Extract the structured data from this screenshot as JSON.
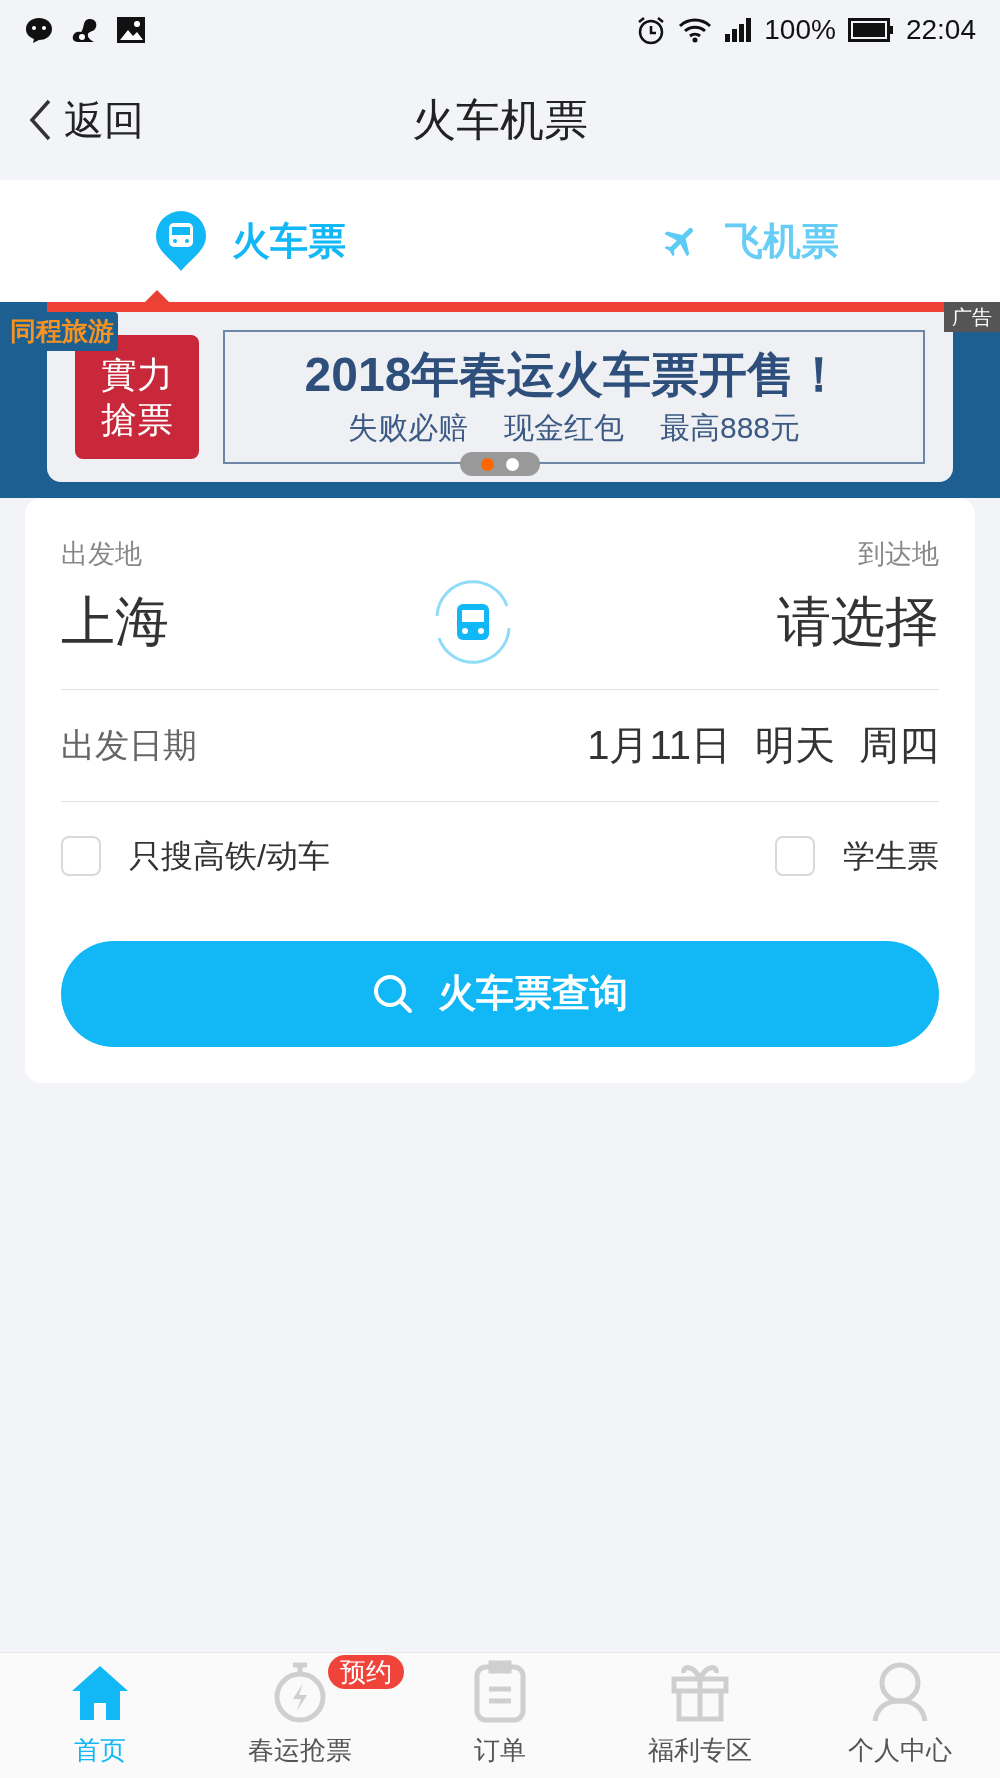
{
  "status_bar": {
    "battery": "100%",
    "time": "22:04"
  },
  "header": {
    "back": "返回",
    "title": "火车机票"
  },
  "tabs": [
    {
      "label": "火车票",
      "kind": "train",
      "selected": true
    },
    {
      "label": "飞机票",
      "kind": "plane",
      "selected": false
    }
  ],
  "banner": {
    "brand": "同程旅游",
    "ad_tag": "广告",
    "stamp": [
      "實力",
      "搶票"
    ],
    "headline": "2018年春运火车票开售！",
    "subline": [
      "失败必赔",
      "现金红包",
      "最高888元"
    ],
    "dots": [
      {
        "selected": true
      },
      {
        "selected": false
      }
    ]
  },
  "form": {
    "from_label": "出发地",
    "from": "上海",
    "to_label": "到达地",
    "to": "请选择",
    "date_label": "出发日期",
    "date": "1月11日",
    "date_hint": "明天",
    "weekday": "周四",
    "options": [
      {
        "label": "只搜高铁/动车",
        "checked": false
      },
      {
        "label": "学生票",
        "checked": false
      }
    ],
    "search_button": "火车票查询"
  },
  "nav": [
    {
      "label": "首页",
      "kind": "home",
      "selected": true
    },
    {
      "label": "春运抢票",
      "kind": "timer",
      "selected": false,
      "badge": "预约"
    },
    {
      "label": "订单",
      "kind": "clipboard",
      "selected": false
    },
    {
      "label": "福利专区",
      "kind": "gift",
      "selected": false
    },
    {
      "label": "个人中心",
      "kind": "person",
      "selected": false
    }
  ]
}
